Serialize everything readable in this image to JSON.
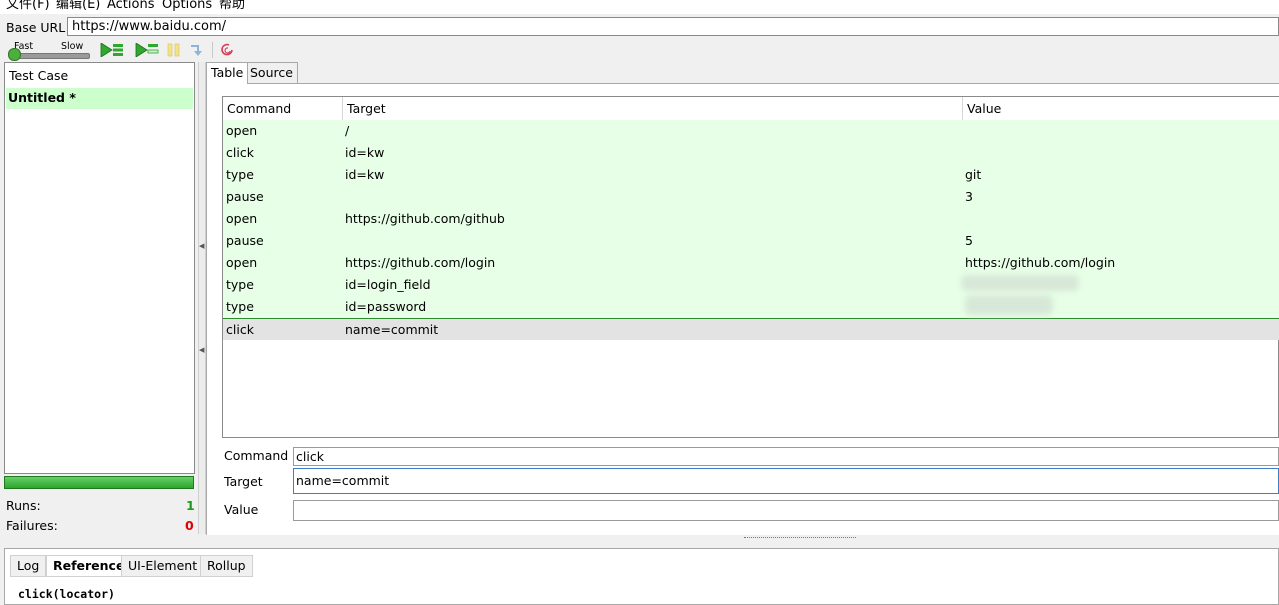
{
  "menu": [
    {
      "label": "文件(F)"
    },
    {
      "label": "编辑(E)"
    },
    {
      "label": "Actions"
    },
    {
      "label": "Options"
    },
    {
      "label": "帮助"
    }
  ],
  "base_url": {
    "label": "Base URL",
    "value": "https://www.baidu.com/"
  },
  "speed": {
    "fast": "Fast",
    "slow": "Slow"
  },
  "testcase": {
    "header": "Test Case",
    "name": "Untitled *"
  },
  "stats": {
    "runs_label": "Runs:",
    "runs": "1",
    "failures_label": "Failures:",
    "failures": "0"
  },
  "tabs": {
    "table": "Table",
    "source": "Source"
  },
  "table": {
    "headers": [
      "Command",
      "Target",
      "Value"
    ],
    "rows": [
      {
        "command": "open",
        "target": "/",
        "value": ""
      },
      {
        "command": "click",
        "target": "id=kw",
        "value": ""
      },
      {
        "command": "type",
        "target": "id=kw",
        "value": "git"
      },
      {
        "command": "pause",
        "target": "",
        "value": "3"
      },
      {
        "command": "open",
        "target": "https://github.com/github",
        "value": ""
      },
      {
        "command": "pause",
        "target": "",
        "value": "5"
      },
      {
        "command": "open",
        "target": "https://github.com/login",
        "value": "https://github.com/login"
      },
      {
        "command": "type",
        "target": "id=login_field",
        "value": ""
      },
      {
        "command": "type",
        "target": "id=password",
        "value": ""
      },
      {
        "command": "click",
        "target": "name=commit",
        "value": ""
      }
    ]
  },
  "editor": {
    "command_label": "Command",
    "command_value": "click",
    "target_label": "Target",
    "target_value": "name=commit",
    "value_label": "Value",
    "value_value": ""
  },
  "bottom_tabs": [
    "Log",
    "Reference",
    "UI-Element",
    "Rollup"
  ],
  "reference_text": "click(locator)",
  "colors": {
    "row_green": "#e6ffe6",
    "selected_row": "#e3e3e3",
    "testcase_green": "#ccffcc",
    "runs_green": "#1a9c1a",
    "failures_red": "#e00000"
  }
}
